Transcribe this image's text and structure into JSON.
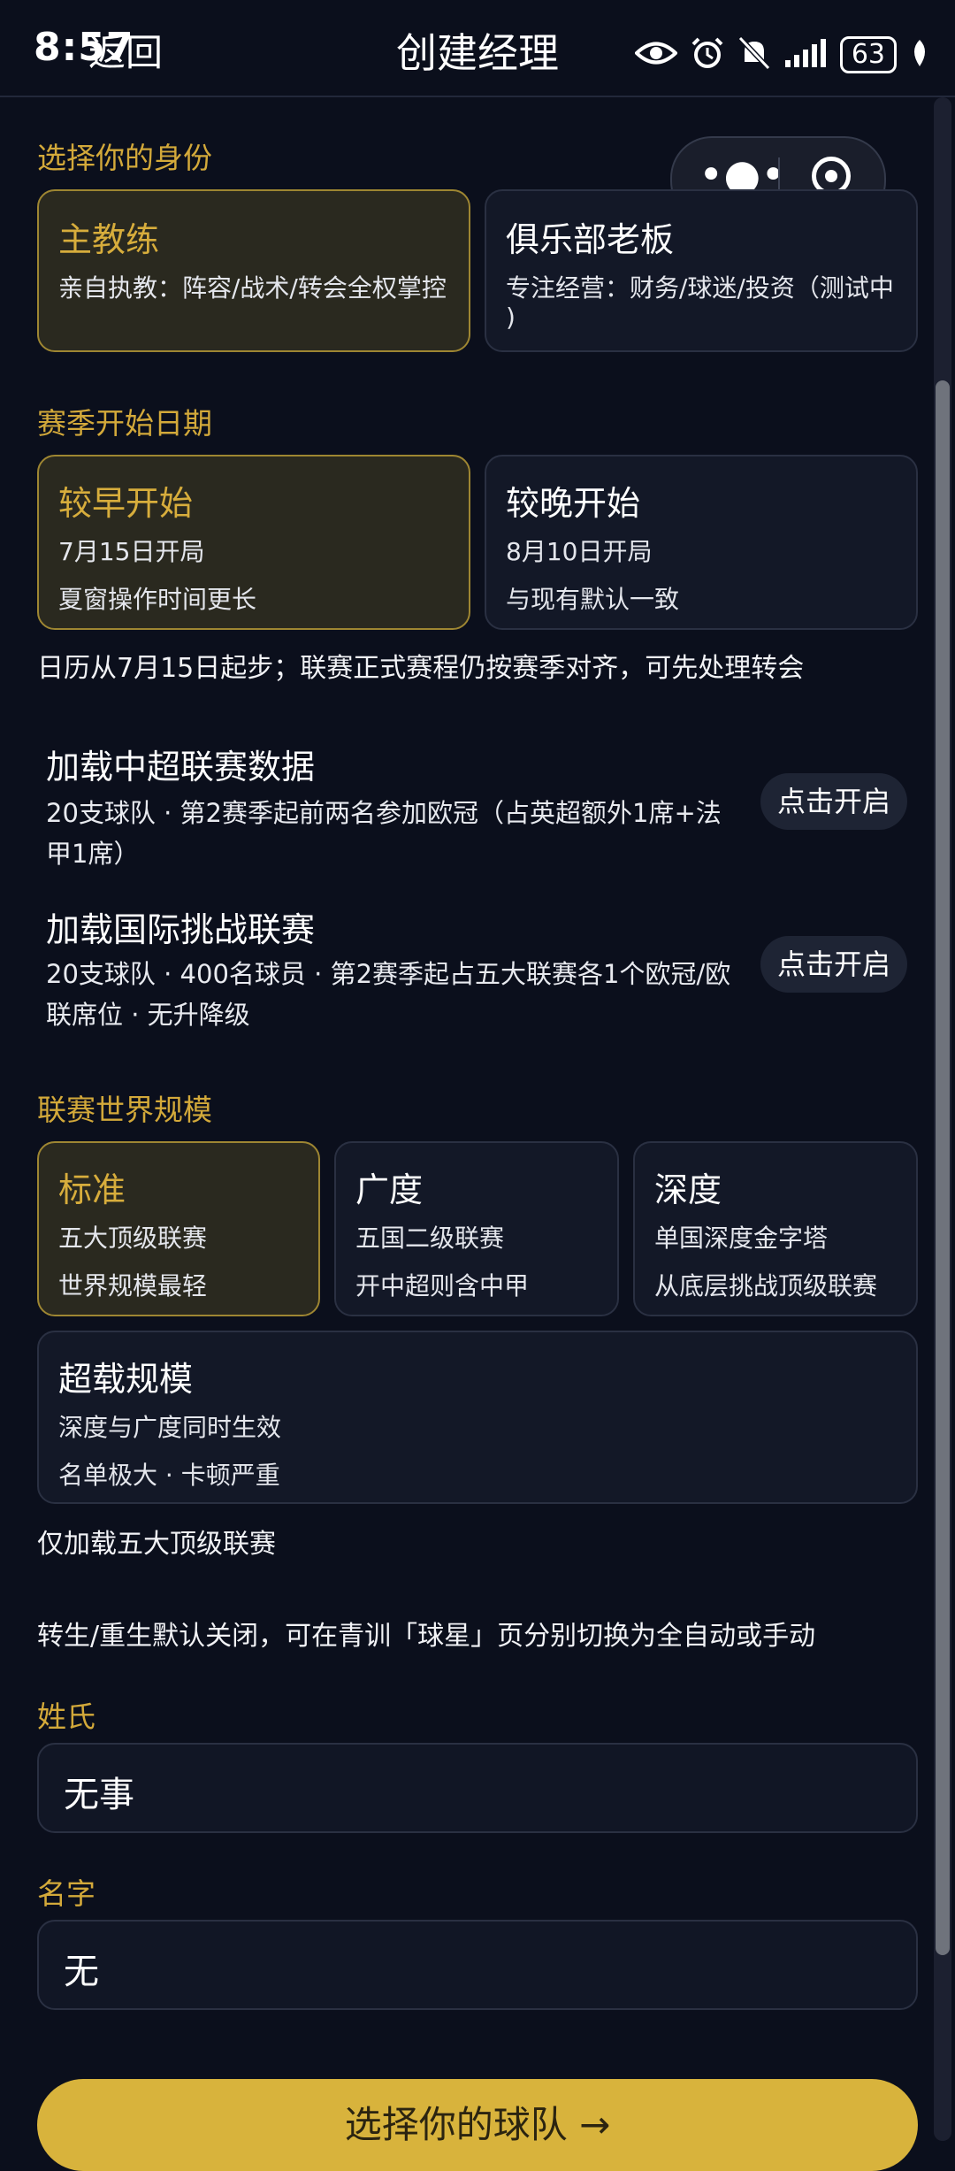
{
  "status_bar": {
    "time": "8:57",
    "battery": "63"
  },
  "nav": {
    "back_label": "返回",
    "title": "创建经理"
  },
  "identity": {
    "section_label": "选择你的身份",
    "options": [
      {
        "title": "主教练",
        "desc": "亲自执教：阵容/战术/转会全权掌控",
        "selected": true
      },
      {
        "title": "俱乐部老板",
        "desc": "专注经营：财务/球迷/投资（测试中",
        "desc2": ")",
        "selected": false
      }
    ]
  },
  "season": {
    "section_label": "赛季开始日期",
    "options": [
      {
        "title": "较早开始",
        "line1": "7月15日开局",
        "line2": "夏窗操作时间更长",
        "selected": true
      },
      {
        "title": "较晚开始",
        "line1": "8月10日开局",
        "line2": "与现有默认一致",
        "selected": false
      }
    ],
    "note": "日历从7月15日起步；联赛正式赛程仍按赛季对齐，可先处理转会"
  },
  "toggles": [
    {
      "title": "加载中超联赛数据",
      "desc": "20支球队 · 第2赛季起前两名参加欧冠（占英超额外1席+法甲1席）",
      "button": "点击开启"
    },
    {
      "title": "加载国际挑战联赛",
      "desc": "20支球队 · 400名球员 · 第2赛季起占五大联赛各1个欧冠/欧联席位 · 无升降级",
      "button": "点击开启"
    }
  ],
  "world_scale": {
    "section_label": "联赛世界规模",
    "options": [
      {
        "title": "标准",
        "line1": "五大顶级联赛",
        "line2": "世界规模最轻",
        "selected": true
      },
      {
        "title": "广度",
        "line1": "五国二级联赛",
        "line2": "开中超则含中甲",
        "selected": false
      },
      {
        "title": "深度",
        "line1": "单国深度金字塔",
        "line2": "从底层挑战顶级联赛",
        "selected": false
      },
      {
        "title": "超载规模",
        "line1": "深度与广度同时生效",
        "line2": "名单极大 · 卡顿严重",
        "selected": false
      }
    ],
    "note": "仅加载五大顶级联赛"
  },
  "rebirth_note": "转生/重生默认关闭，可在青训「球星」页分别切换为全自动或手动",
  "surname": {
    "label": "姓氏",
    "value": "无事"
  },
  "given_name": {
    "label": "名字",
    "value": "无"
  },
  "cta_label": "选择你的球队 →",
  "colors": {
    "accent": "#d8b33c",
    "background": "#0b0f1c"
  }
}
